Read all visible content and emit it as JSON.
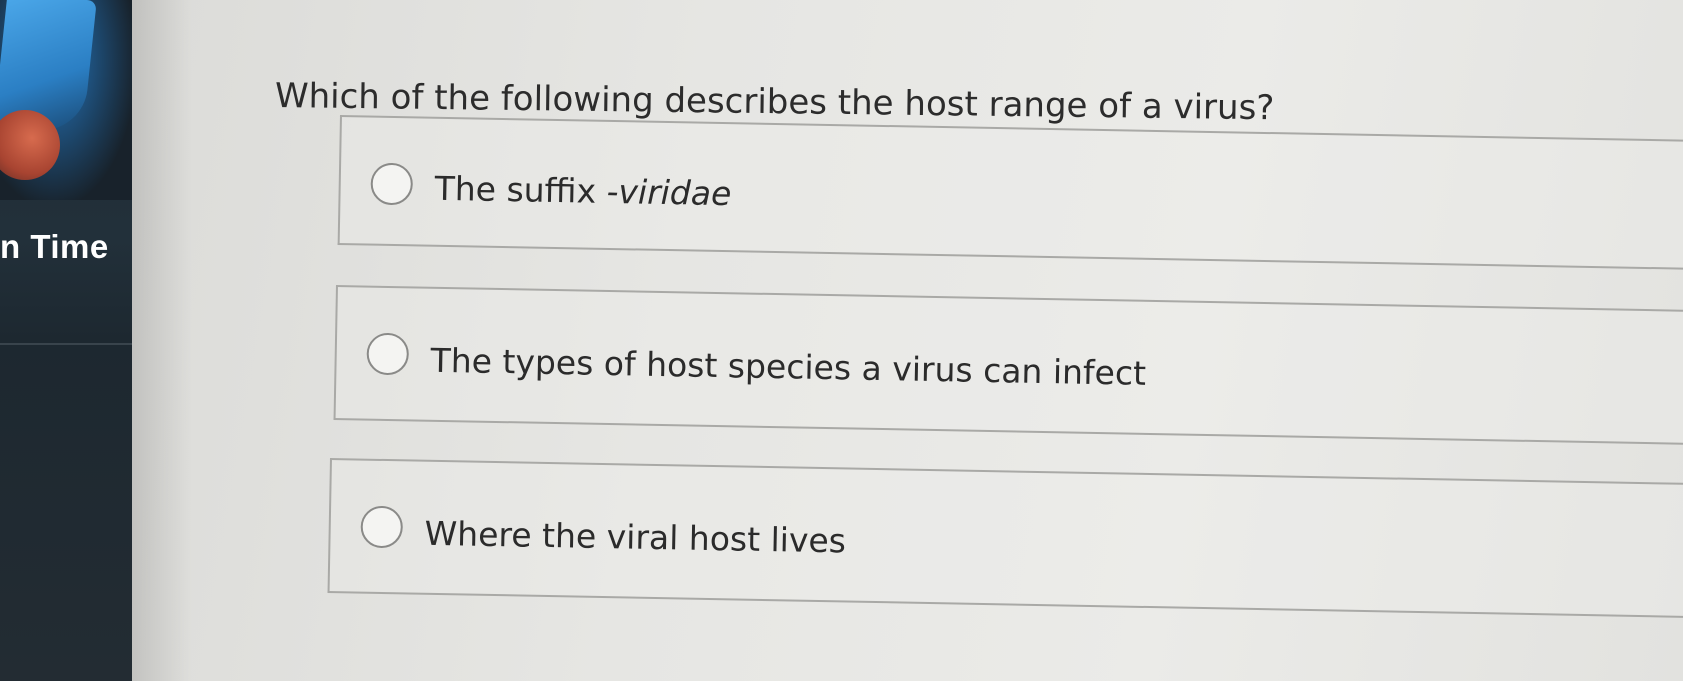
{
  "left_panel": {
    "time_label": "n Time"
  },
  "question": {
    "text": "Which of the following describes the host range of a virus?"
  },
  "options": [
    {
      "text_plain": "The suffix ",
      "text_italic": "-viridae",
      "selected": false
    },
    {
      "text_plain": "The types of host species a virus can infect",
      "text_italic": "",
      "selected": false
    },
    {
      "text_plain": "Where the viral host lives",
      "text_italic": "",
      "selected": false
    }
  ],
  "icons": {
    "radio": "radio-unselected-icon"
  }
}
